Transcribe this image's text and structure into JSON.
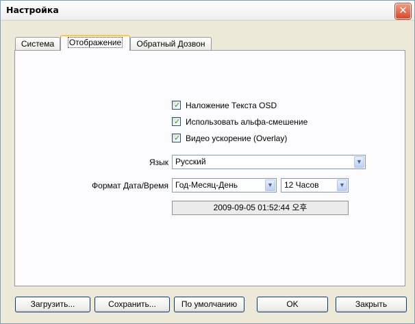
{
  "window": {
    "title": "Настройка",
    "close_icon": "close-icon"
  },
  "tabs": [
    {
      "label": "Система",
      "active": false
    },
    {
      "label": "Отображение",
      "active": true
    },
    {
      "label": "Обратный Дозвон",
      "active": false
    }
  ],
  "display": {
    "osd_text": {
      "label": "Наложение Текста OSD",
      "checked": true
    },
    "alpha_blend": {
      "label": "Использовать альфа-смешение",
      "checked": true
    },
    "video_overlay": {
      "label": "Видео ускорение (Overlay)",
      "checked": true
    },
    "language": {
      "label": "Язык",
      "value": "Русский"
    },
    "datetime_format": {
      "label": "Формат Дата/Время",
      "date_value": "Год-Месяц-День",
      "time_value": "12 Часов"
    },
    "preview": "2009-09-05 01:52:44 오후"
  },
  "buttons": {
    "load": "Загрузить...",
    "save": "Сохранить...",
    "default": "По умолчанию",
    "ok": "OK",
    "close": "Закрыть"
  },
  "colors": {
    "check_mark": "#21a121",
    "active_tab_accent": "#ffc83c",
    "close_button": "#d8492c"
  }
}
